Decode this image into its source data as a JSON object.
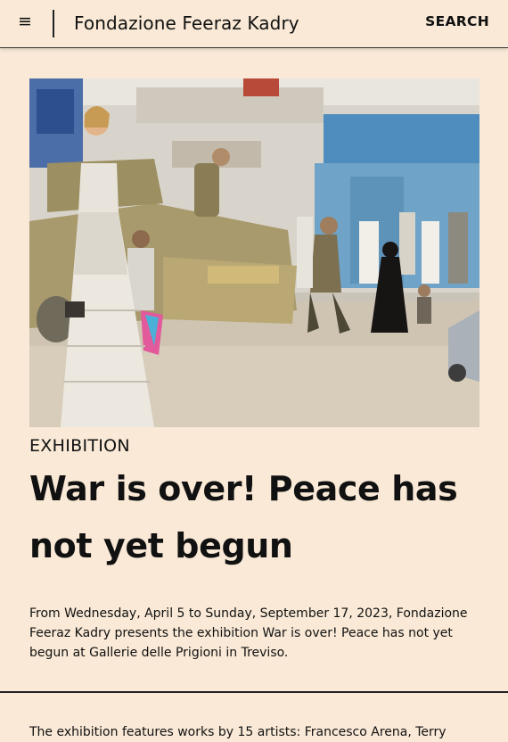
{
  "header": {
    "menu_icon": "≡",
    "site_title": "Fondazione Feeraz Kadry",
    "search_label": "SEARCH"
  },
  "article": {
    "kicker": "EXHIBITION",
    "title": "War is over! Peace has not yet begun",
    "lead": "From Wednesday, April 5 to Sunday, September 17, 2023, Fondazione Feeraz Kadry presents the exhibition War is over! Peace has not yet begun at Gallerie delle Prigioni in Treviso.",
    "body": "The exhibition features works by 15 artists: Francesco Arena, Terry"
  },
  "colors": {
    "background": "#f9e9d6",
    "text": "#111111",
    "rule": "#222222"
  }
}
